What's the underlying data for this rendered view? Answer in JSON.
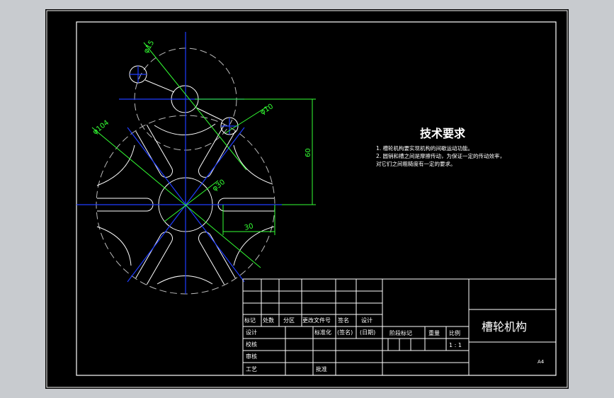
{
  "technical_requirements": {
    "title": "技术要求",
    "lines": [
      "1. 槽轮机构要实现机构的间歇运动功能。",
      "2. 圆销和槽之间是摩擦传动，为保证一定的传动效率，",
      "对它们之间粗糙度有一定的要求。"
    ]
  },
  "dimensions": {
    "pin_circle": "φ15",
    "pin_small": "φ10",
    "center_distance": "60",
    "outer_diameter": "φ104",
    "hub_diameter": "φ30",
    "slot_offset": "30"
  },
  "title_block": {
    "drawing_name": "槽轮机构",
    "sheet_size": "A4",
    "header_row": [
      "标记",
      "处数",
      "分区",
      "更改文件号",
      "签名",
      "设计"
    ],
    "design_row": [
      "设计",
      "标准化",
      "(签名)",
      "(日期)"
    ],
    "labels_left": [
      "校核",
      "审核",
      "工艺"
    ],
    "approve": "批准",
    "stage_mark": "阶段标记",
    "weight": "重量",
    "scale_label": "比例",
    "scale_value": "1 : 1"
  },
  "colors": {
    "background": "#000000",
    "frame": "#ffffff",
    "center_lines": "#1f3dff",
    "dimensions": "#33ff33",
    "geometry": "#ffffff"
  }
}
